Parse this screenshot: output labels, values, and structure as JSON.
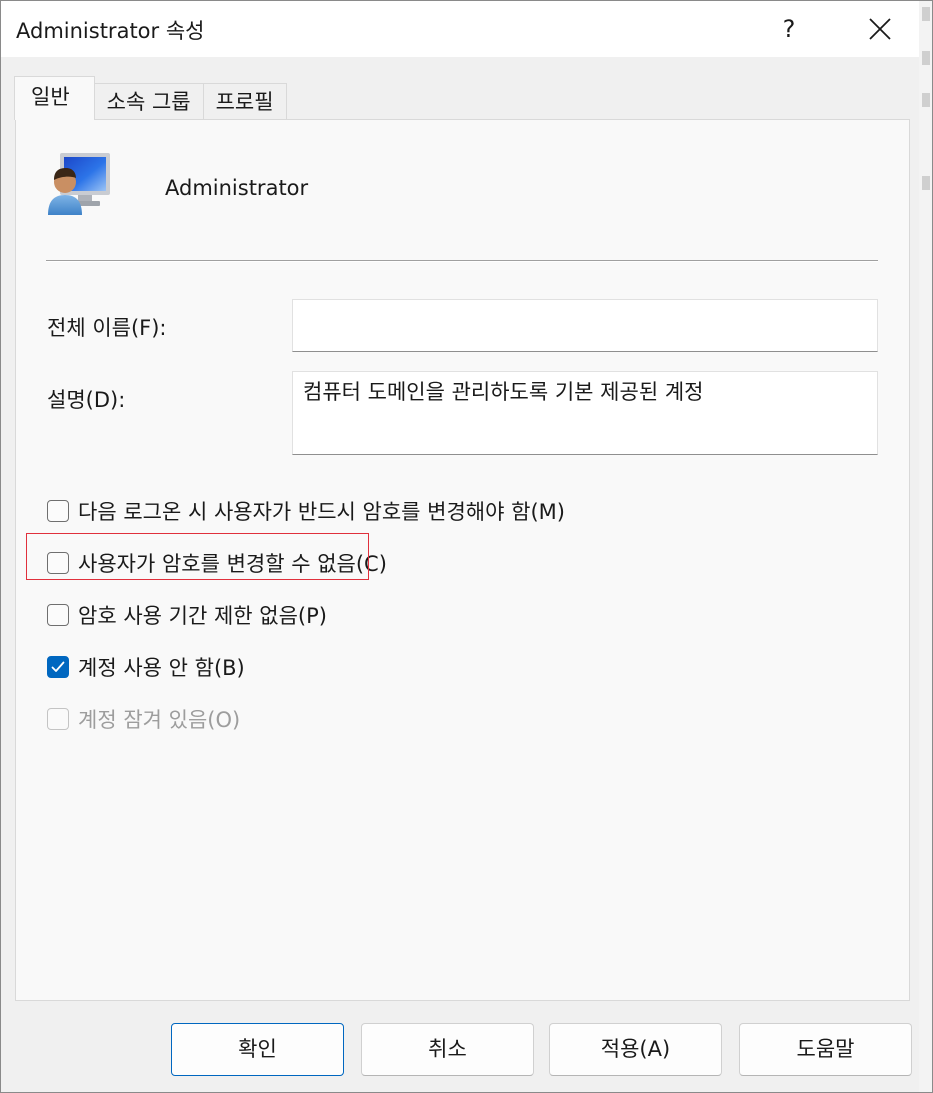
{
  "window": {
    "title": "Administrator 속성",
    "help_label": "?"
  },
  "tabs": [
    {
      "label": "일반",
      "active": true
    },
    {
      "label": "소속 그룹",
      "active": false
    },
    {
      "label": "프로필",
      "active": false
    }
  ],
  "general": {
    "user_name": "Administrator",
    "full_name_label": "전체 이름(F):",
    "full_name_value": "",
    "description_label": "설명(D):",
    "description_value": "컴퓨터 도메인을 관리하도록 기본 제공된 계정",
    "checkboxes": [
      {
        "label": "다음 로그온 시 사용자가 반드시 암호를 변경해야 함(M)",
        "checked": false,
        "enabled": true
      },
      {
        "label": "사용자가 암호를 변경할 수 없음(C)",
        "checked": false,
        "enabled": true
      },
      {
        "label": "암호 사용 기간 제한 없음(P)",
        "checked": false,
        "enabled": true,
        "highlighted": true
      },
      {
        "label": "계정 사용 안 함(B)",
        "checked": true,
        "enabled": true
      },
      {
        "label": "계정 잠겨 있음(O)",
        "checked": false,
        "enabled": false
      }
    ]
  },
  "buttons": {
    "ok": "확인",
    "cancel": "취소",
    "apply": "적용(A)",
    "help": "도움말"
  },
  "colors": {
    "accent": "#0067c0",
    "highlight": "#e0303c"
  }
}
